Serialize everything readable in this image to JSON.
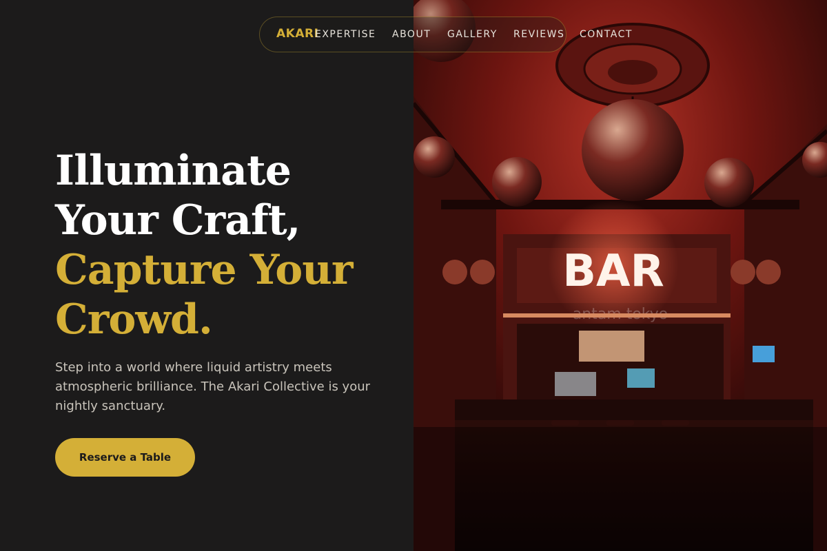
{
  "nav": {
    "logo": "AKARI",
    "links": [
      "EXPERTISE",
      "ABOUT",
      "GALLERY",
      "REVIEWS",
      "CONTACT"
    ]
  },
  "hero": {
    "headline_lines": [
      "Illuminate",
      "Your Craft,",
      "Capture Your",
      "Crowd."
    ],
    "description": "Step into a world where liquid artistry meets atmospheric brilliance. The Akari Collective is your nightly sanctuary.",
    "cta_label": "Reserve a Table"
  },
  "photo": {
    "sign_text": "BAR",
    "watermark": "antam tokyo"
  },
  "colors": {
    "background": "#1c1b1b",
    "accent_gold": "#d4af37",
    "text_white": "#ffffff",
    "text_muted": "#c9c4bb"
  }
}
